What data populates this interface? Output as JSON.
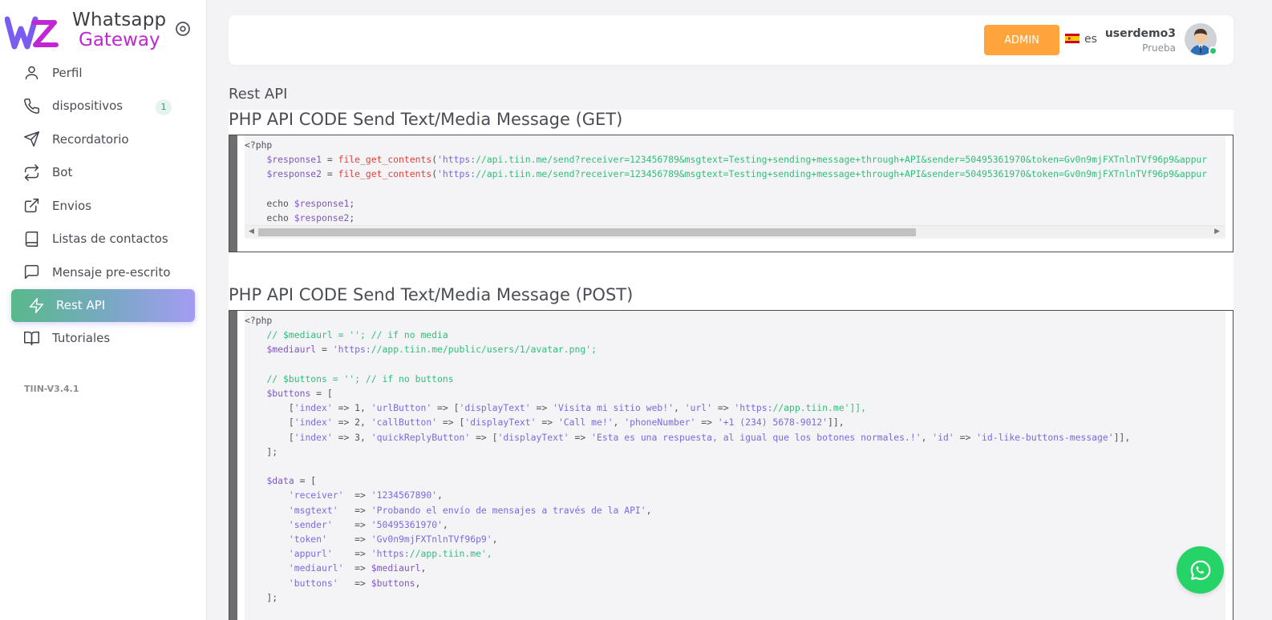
{
  "brand": {
    "line1": "Whatsapp",
    "line2": "Gateway",
    "logo_text": "WZ"
  },
  "sidebar": {
    "items": [
      {
        "label": "Perfil",
        "icon": "user-icon"
      },
      {
        "label": "dispositivos",
        "icon": "phone-icon",
        "badge": "1"
      },
      {
        "label": "Recordatorio",
        "icon": "send-icon"
      },
      {
        "label": "Bot",
        "icon": "repeat-icon"
      },
      {
        "label": "Envios",
        "icon": "external-link-icon"
      },
      {
        "label": "Listas de contactos",
        "icon": "book-icon"
      },
      {
        "label": "Mensaje pre-escrito",
        "icon": "message-square-icon"
      },
      {
        "label": "Rest API",
        "icon": "zap-icon",
        "active": true
      },
      {
        "label": "Tutoriales",
        "icon": "book-open-icon"
      }
    ],
    "version": "TIIN-V3.4.1"
  },
  "header": {
    "admin_label": "ADMIN",
    "language": "es",
    "username": "userdemo3",
    "role": "Prueba"
  },
  "main": {
    "page_title": "Rest API",
    "get_section_title": "PHP API CODE Send Text/Media Message (GET)",
    "post_section_title": "PHP API CODE Send Text/Media Message (POST)",
    "get_code": [
      "<?php",
      "    $response1 = file_get_contents('https://api.tiin.me/send?receiver=123456789&msgtext=Testing+sending+message+through+API&sender=50495361970&token=Gv0n9mjFXTnlnTVf96p9&appur",
      "    $response2 = file_get_contents('https://api.tiin.me/send?receiver=123456789&msgtext=Testing+sending+message+through+API&sender=50495361970&token=Gv0n9mjFXTnlnTVf96p9&appur",
      "",
      "    echo $response1;",
      "    echo $response2;"
    ],
    "post_code": [
      "<?php",
      "    // $mediaurl = ''; // if no media",
      "    $mediaurl = 'https://app.tiin.me/public/users/1/avatar.png';",
      "",
      "    // $buttons = ''; // if no buttons",
      "    $buttons = [",
      "        ['index' => 1, 'urlButton' => ['displayText' => 'Visita mi sitio web!', 'url' => 'https://app.tiin.me']],",
      "        ['index' => 2, 'callButton' => ['displayText' => 'Call me!', 'phoneNumber' => '+1 (234) 5678-9012']],",
      "        ['index' => 3, 'quickReplyButton' => ['displayText' => 'Esta es una respuesta, al igual que los botones normales.!', 'id' => 'id-like-buttons-message']],",
      "    ];",
      "",
      "    $data = [",
      "        'receiver'  => '1234567890',",
      "        'msgtext'   => 'Probando el envío de mensajes a través de la API',",
      "        'sender'    => '50495361970',",
      "        'token'     => 'Gv0n9mjFXTnlnTVf96p9',",
      "        'appurl'    => 'https://app.tiin.me',",
      "        'mediaurl'  => $mediaurl,",
      "        'buttons'   => $buttons,",
      "    ];"
    ]
  },
  "colors": {
    "accent_orange": "#ffa53b",
    "active_gradient_start": "#58b98a",
    "active_gradient_end": "#a49cf2",
    "brand_purple": "#c026d3",
    "whatsapp_green": "#25d366"
  },
  "icons": {
    "whatsapp_fab": "whatsapp-icon",
    "settings": "circle-dot-icon",
    "flag": "spain-flag-icon"
  }
}
